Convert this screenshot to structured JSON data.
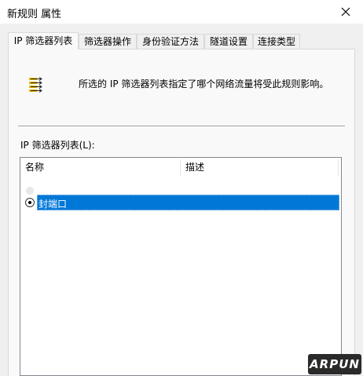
{
  "window": {
    "title": "新规则 属性",
    "close_icon": "close-icon"
  },
  "tabs": [
    {
      "label": "IP 筛选器列表",
      "active": true
    },
    {
      "label": "筛选器操作",
      "active": false
    },
    {
      "label": "身份验证方法",
      "active": false
    },
    {
      "label": "隧道设置",
      "active": false
    },
    {
      "label": "连接类型",
      "active": false
    }
  ],
  "panel": {
    "icon": "ip-filter-list-icon",
    "description": "所选的 IP 筛选器列表指定了哪个网络流量将受此规则影响。",
    "list_label": "IP 筛选器列表(L):"
  },
  "list": {
    "columns": [
      "名称",
      "描述"
    ],
    "rows": [
      {
        "name": "封端口",
        "description": "",
        "selected": true
      }
    ]
  },
  "watermark": "ARPUN",
  "colors": {
    "selection": "#0078d7",
    "background": "#f0f0f0",
    "panel": "#f9f9f9"
  }
}
